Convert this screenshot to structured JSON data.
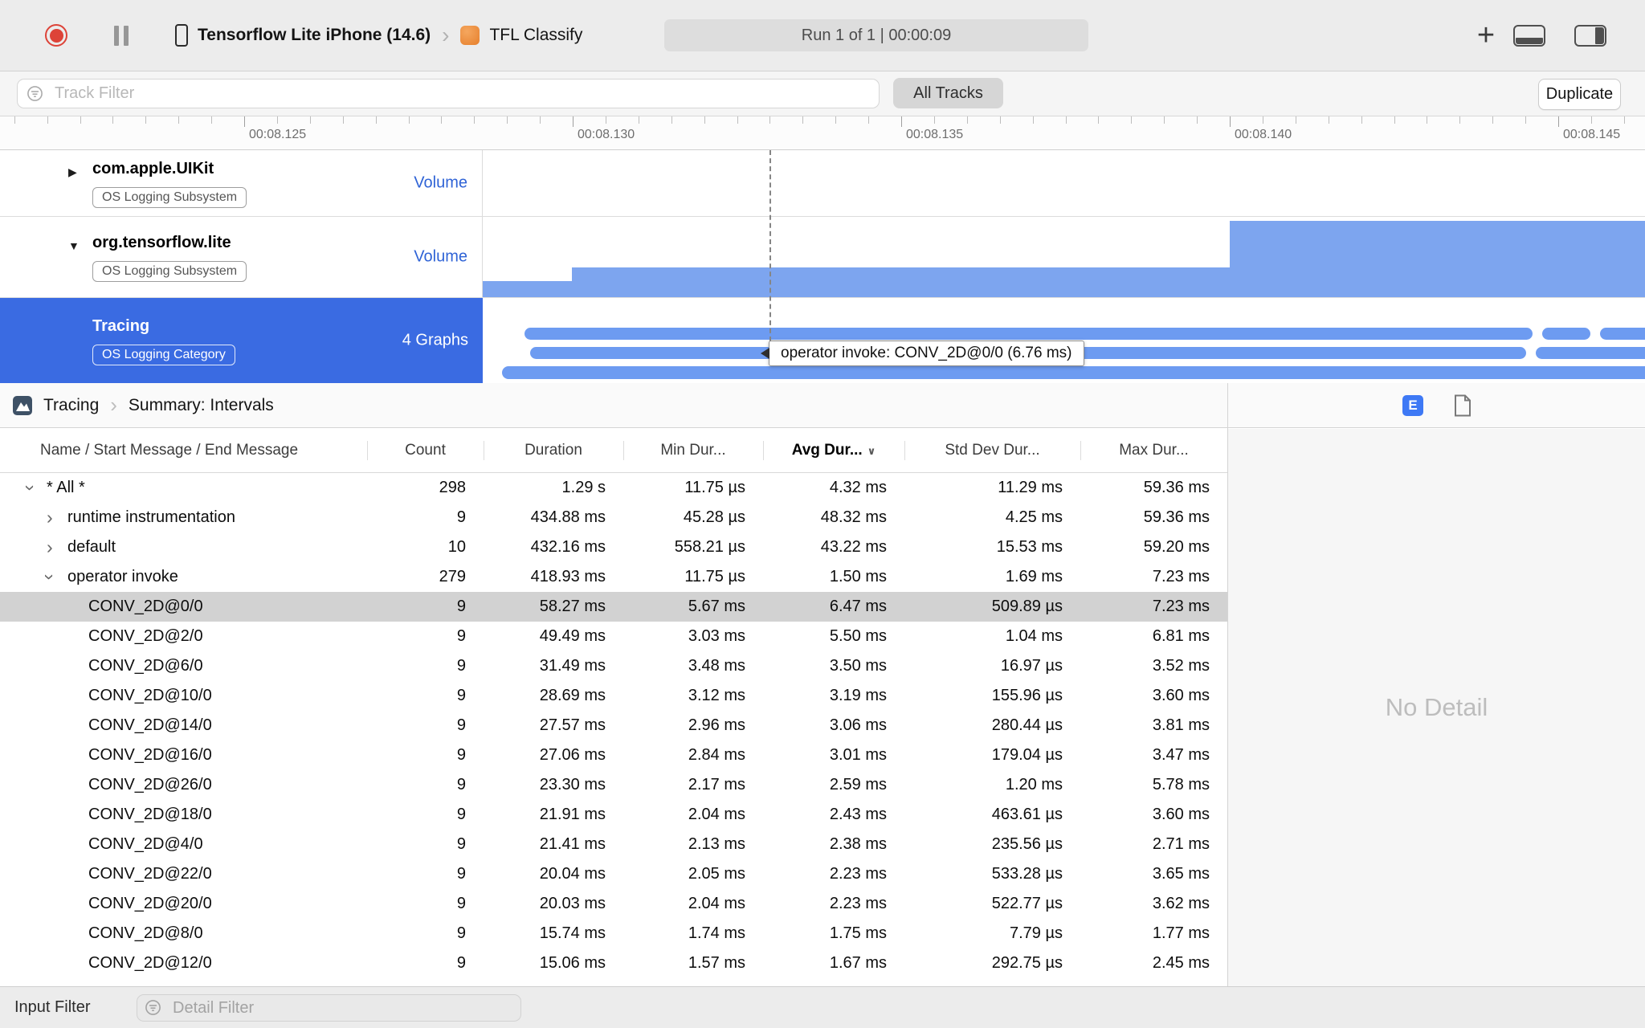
{
  "toolbar": {
    "device_name": "Tensorflow Lite iPhone (14.6)",
    "target_name": "TFL Classify",
    "run_status": "Run 1 of 1   |   00:00:09"
  },
  "filter_bar": {
    "track_filter_placeholder": "Track Filter",
    "all_tracks_label": "All Tracks",
    "duplicate_label": "Duplicate"
  },
  "ruler": {
    "labels": [
      "00:08.125",
      "00:08.130",
      "00:08.135",
      "00:08.140",
      "00:08.145"
    ]
  },
  "tracks": [
    {
      "name": "com.apple.UIKit",
      "badge": "OS Logging Subsystem",
      "lane_label": "Volume",
      "disclosure": "collapsed",
      "selected": false
    },
    {
      "name": "org.tensorflow.lite",
      "badge": "OS Logging Subsystem",
      "lane_label": "Volume",
      "disclosure": "expanded",
      "selected": false
    },
    {
      "name": "Tracing",
      "badge": "OS Logging Category",
      "lane_label": "4 Graphs",
      "disclosure": "expanded",
      "selected": true
    }
  ],
  "tooltip": {
    "text": "operator invoke: CONV_2D@0/0 (6.76 ms)"
  },
  "detail_header": {
    "root": "Tracing",
    "page": "Summary: Intervals",
    "expanded_detail_button": "E"
  },
  "table": {
    "columns": [
      "Name / Start Message / End Message",
      "Count",
      "Duration",
      "Min Dur...",
      "Avg Dur...",
      "Std Dev Dur...",
      "Max Dur..."
    ],
    "sorted_column": "Avg Dur...",
    "rows": [
      {
        "indent": 0,
        "disclosure": "expanded",
        "name": "* All *",
        "values": [
          "298",
          "1.29 s",
          "11.75 µs",
          "4.32 ms",
          "11.29 ms",
          "59.36 ms"
        ]
      },
      {
        "indent": 1,
        "disclosure": "collapsed",
        "name": "runtime instrumentation",
        "values": [
          "9",
          "434.88 ms",
          "45.28 µs",
          "48.32 ms",
          "4.25 ms",
          "59.36 ms"
        ]
      },
      {
        "indent": 1,
        "disclosure": "collapsed",
        "name": "default",
        "values": [
          "10",
          "432.16 ms",
          "558.21 µs",
          "43.22 ms",
          "15.53 ms",
          "59.20 ms"
        ]
      },
      {
        "indent": 1,
        "disclosure": "expanded",
        "name": "operator invoke",
        "values": [
          "279",
          "418.93 ms",
          "11.75 µs",
          "1.50 ms",
          "1.69 ms",
          "7.23 ms"
        ]
      },
      {
        "indent": 2,
        "name": "CONV_2D@0/0",
        "selected": true,
        "values": [
          "9",
          "58.27 ms",
          "5.67 ms",
          "6.47 ms",
          "509.89 µs",
          "7.23 ms"
        ]
      },
      {
        "indent": 2,
        "name": "CONV_2D@2/0",
        "values": [
          "9",
          "49.49 ms",
          "3.03 ms",
          "5.50 ms",
          "1.04 ms",
          "6.81 ms"
        ]
      },
      {
        "indent": 2,
        "name": "CONV_2D@6/0",
        "values": [
          "9",
          "31.49 ms",
          "3.48 ms",
          "3.50 ms",
          "16.97 µs",
          "3.52 ms"
        ]
      },
      {
        "indent": 2,
        "name": "CONV_2D@10/0",
        "values": [
          "9",
          "28.69 ms",
          "3.12 ms",
          "3.19 ms",
          "155.96 µs",
          "3.60 ms"
        ]
      },
      {
        "indent": 2,
        "name": "CONV_2D@14/0",
        "values": [
          "9",
          "27.57 ms",
          "2.96 ms",
          "3.06 ms",
          "280.44 µs",
          "3.81 ms"
        ]
      },
      {
        "indent": 2,
        "name": "CONV_2D@16/0",
        "values": [
          "9",
          "27.06 ms",
          "2.84 ms",
          "3.01 ms",
          "179.04 µs",
          "3.47 ms"
        ]
      },
      {
        "indent": 2,
        "name": "CONV_2D@26/0",
        "values": [
          "9",
          "23.30 ms",
          "2.17 ms",
          "2.59 ms",
          "1.20 ms",
          "5.78 ms"
        ]
      },
      {
        "indent": 2,
        "name": "CONV_2D@18/0",
        "values": [
          "9",
          "21.91 ms",
          "2.04 ms",
          "2.43 ms",
          "463.61 µs",
          "3.60 ms"
        ]
      },
      {
        "indent": 2,
        "name": "CONV_2D@4/0",
        "values": [
          "9",
          "21.41 ms",
          "2.13 ms",
          "2.38 ms",
          "235.56 µs",
          "2.71 ms"
        ]
      },
      {
        "indent": 2,
        "name": "CONV_2D@22/0",
        "values": [
          "9",
          "20.04 ms",
          "2.05 ms",
          "2.23 ms",
          "533.28 µs",
          "3.65 ms"
        ]
      },
      {
        "indent": 2,
        "name": "CONV_2D@20/0",
        "values": [
          "9",
          "20.03 ms",
          "2.04 ms",
          "2.23 ms",
          "522.77 µs",
          "3.62 ms"
        ]
      },
      {
        "indent": 2,
        "name": "CONV_2D@8/0",
        "values": [
          "9",
          "15.74 ms",
          "1.74 ms",
          "1.75 ms",
          "7.79 µs",
          "1.77 ms"
        ]
      },
      {
        "indent": 2,
        "name": "CONV_2D@12/0",
        "values": [
          "9",
          "15.06 ms",
          "1.57 ms",
          "1.67 ms",
          "292.75 µs",
          "2.45 ms"
        ]
      }
    ]
  },
  "detail_pane": {
    "no_detail": "No Detail"
  },
  "bottom_bar": {
    "input_filter_label": "Input Filter",
    "detail_filter_placeholder": "Detail Filter"
  }
}
